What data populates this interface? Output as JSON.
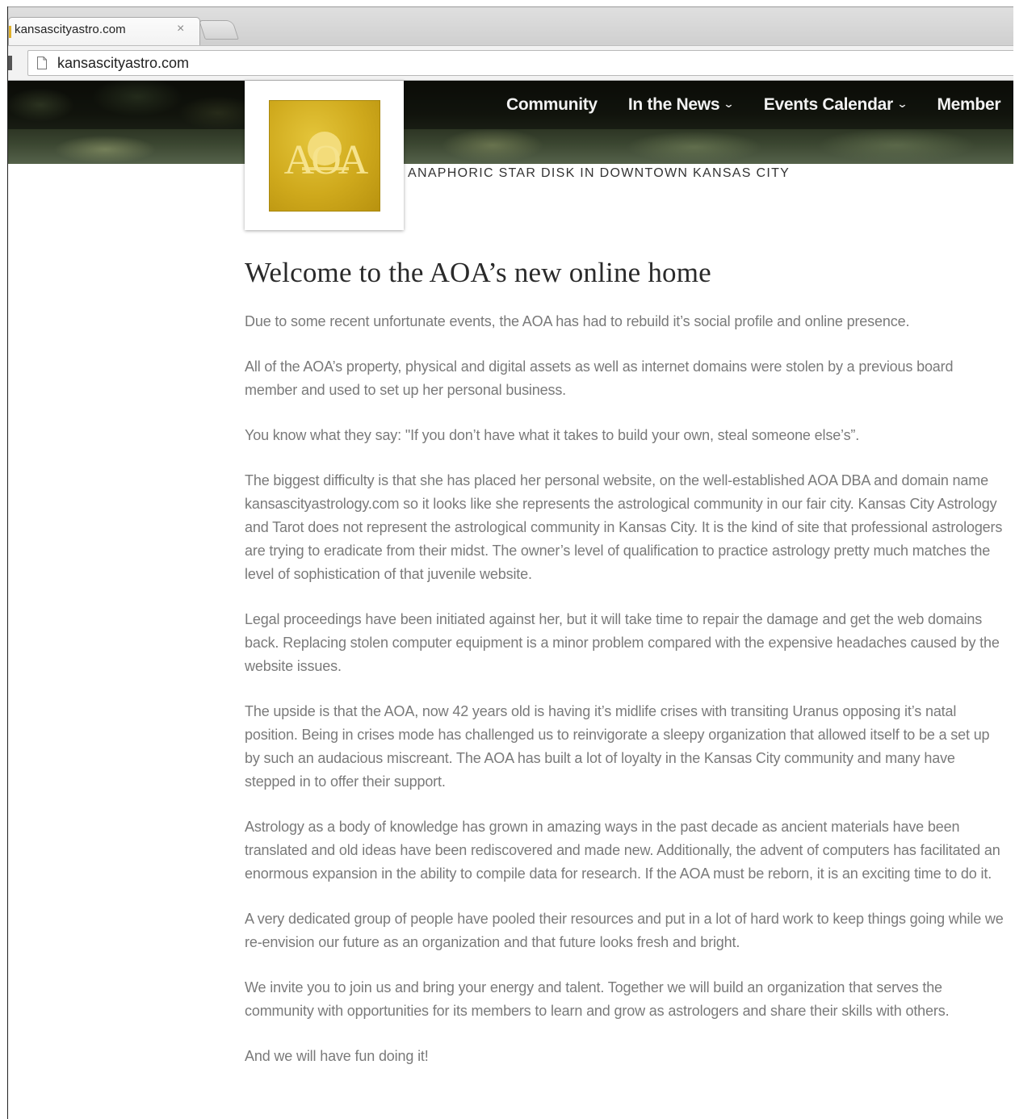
{
  "browser": {
    "tab": {
      "title": "kansascityastro.com",
      "close_label": "×"
    },
    "address_bar": {
      "url": "kansascityastro.com"
    }
  },
  "site": {
    "nav": {
      "items": [
        {
          "label": "Community",
          "has_dropdown": false
        },
        {
          "label": "In the News",
          "has_dropdown": true
        },
        {
          "label": "Events Calendar",
          "has_dropdown": true
        },
        {
          "label": "Member",
          "has_dropdown": false
        }
      ],
      "dropdown_glyph": "⌄"
    },
    "logo": {
      "text": "AOA",
      "icon": "aoa-sun-logo-icon",
      "color": "#cfa91c"
    },
    "tagline": "ANAPHORIC STAR DISK IN DOWNTOWN KANSAS CITY"
  },
  "article": {
    "title": "Welcome to the AOA’s new online home",
    "paragraphs": [
      "Due to some recent unfortunate events, the AOA has had to rebuild it’s social profile and online presence.",
      "All of the AOA’s property, physical and digital assets as well as internet domains were stolen by a previous board member and used to set up her personal business.",
      "You know what they say: \"If you don’t have what it takes to build your own, steal someone else’s”.",
      "The biggest difficulty is that she has placed her personal website, on the well-established AOA DBA and domain name kansascityastrology.com so it looks like she represents the astrological community in our fair city. Kansas City Astrology and Tarot does not represent the astrological community in Kansas City. It is the kind of site that professional astrologers are trying to eradicate from their midst. The owner’s level of qualification to practice astrology pretty much matches the level of sophistication of that juvenile website.",
      "Legal proceedings have been initiated against her, but it will take time to repair the damage and get the web domains back. Replacing stolen computer equipment is a minor problem compared with the expensive headaches caused by the website issues.",
      "The upside is that the AOA, now 42 years old is having it’s midlife crises with transiting Uranus opposing it’s natal position. Being in crises mode has challenged us to reinvigorate a sleepy organization that allowed itself to be a set up by such an audacious miscreant. The AOA has built a lot of loyalty in the Kansas City community and many have stepped in to offer their support.",
      "Astrology as a body of knowledge has grown in amazing ways in the past decade as ancient materials have been translated and old ideas have been rediscovered and made new. Additionally, the advent of computers has facilitated an enormous expansion in the ability to compile data for research. If the AOA must be reborn, it is an exciting time to do it.",
      "A very dedicated group of people have pooled their resources and put in a lot of hard work to keep things going while we re-envision our future as an organization and that future looks fresh and bright.",
      "We invite you to join us and bring your energy and talent. Together we will build an organization that serves the community with opportunities for its members to learn and grow as astrologers and share their skills with others.",
      "And we will have fun doing it!"
    ]
  },
  "colors": {
    "header_dark": "#15170f",
    "body_text": "#7a7a7a",
    "title_text": "#2a2a2a",
    "nav_text": "#f2f2f2"
  }
}
